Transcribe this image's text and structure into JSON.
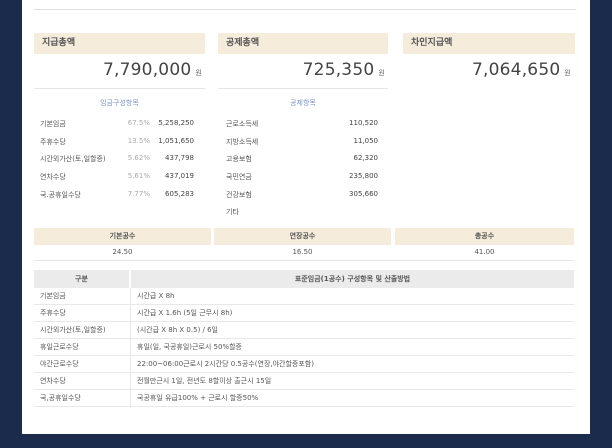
{
  "summary": {
    "pay_total": {
      "label": "지급총액",
      "value": "7,790,000",
      "unit": "원"
    },
    "deduction_total": {
      "label": "공제총액",
      "value": "725,350",
      "unit": "원"
    },
    "net_pay": {
      "label": "차인지급액",
      "value": "7,064,650",
      "unit": "원"
    }
  },
  "pay_items": {
    "title": "임금구성항목",
    "rows": [
      {
        "label": "기본임금",
        "pct": "67.5%",
        "amount": "5,258,250"
      },
      {
        "label": "주휴수당",
        "pct": "13.5%",
        "amount": "1,051,650"
      },
      {
        "label": "시간외가산(토,일할증)",
        "pct": "5.62%",
        "amount": "437,798"
      },
      {
        "label": "연차수당",
        "pct": "5.61%",
        "amount": "437,019"
      },
      {
        "label": "국.공휴일수당",
        "pct": "7.77%",
        "amount": "605,283"
      }
    ]
  },
  "deductions": {
    "title": "공제항목",
    "rows": [
      {
        "label": "근로소득세",
        "amount": "110,520"
      },
      {
        "label": "지방소득세",
        "amount": "11,050"
      },
      {
        "label": "고용보험",
        "amount": "62,320"
      },
      {
        "label": "국민연금",
        "amount": "235,800"
      },
      {
        "label": "건강보험",
        "amount": "305,660"
      },
      {
        "label": "기타",
        "amount": ""
      }
    ]
  },
  "hours": {
    "basic": {
      "label": "기본공수",
      "value": "24.50"
    },
    "extended": {
      "label": "연장공수",
      "value": "16.50"
    },
    "total": {
      "label": "총공수",
      "value": "41.00"
    }
  },
  "table": {
    "col1": "구분",
    "col2": "표준임금(1공수) 구성항목 및 산출방법",
    "rows": [
      {
        "item": "기본임금",
        "desc": "시간급 X 8h"
      },
      {
        "item": "주휴수당",
        "desc": "시간급 X 1.6h (5일 근무시 8h)"
      },
      {
        "item": "시간외가산(토,일할증)",
        "desc": "(시간급 X 8h X 0.5) / 6일"
      },
      {
        "item": "휴일근로수당",
        "desc": "휴일(일, 국공휴일)근로시 50%할증"
      },
      {
        "item": "야간근로수당",
        "desc": "22:00~06:00근로시 2시간당 0.5공수(연장,야간할증포함)"
      },
      {
        "item": "연차수당",
        "desc": "전월만근시 1일, 전년도 8할이상 출근시 15일"
      },
      {
        "item": "국,공휴일수당",
        "desc": "국공휴일 유급100% + 근로시 할증50%"
      }
    ]
  }
}
